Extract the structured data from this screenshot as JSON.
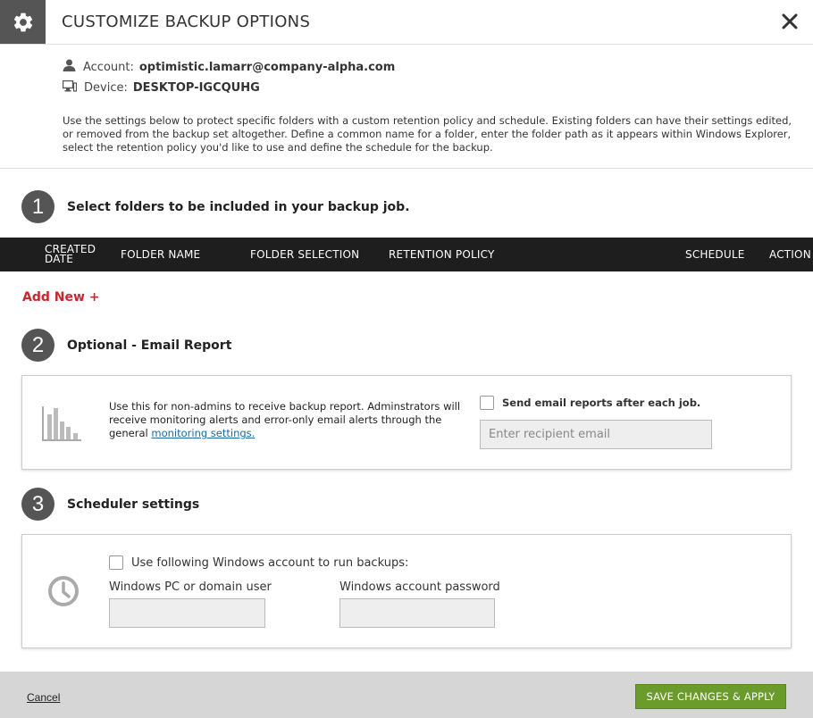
{
  "header": {
    "title": "CUSTOMIZE BACKUP OPTIONS"
  },
  "meta": {
    "account_label": "Account:",
    "account_value": "optimistic.lamarr@company-alpha.com",
    "device_label": "Device:",
    "device_value": "DESKTOP-IGCQUHG",
    "description": "Use the settings below to protect specific folders with a custom retention policy and schedule. Existing folders can have their settings edited, or removed from the backup set altogether. Define a common name for a folder, enter the folder path as it appears within Windows Explorer, select the retention policy you'd like to use and define the schedule for the backup."
  },
  "step1": {
    "number": "1",
    "title": "Select folders to be included in your backup job."
  },
  "table": {
    "columns": {
      "created_date_line1": "CREATED",
      "created_date_line2": "DATE",
      "folder_name": "FOLDER NAME",
      "folder_selection": "FOLDER SELECTION",
      "retention_policy": "RETENTION POLICY",
      "schedule": "SCHEDULE",
      "action": "ACTION"
    }
  },
  "add_new": "Add New +",
  "step2": {
    "number": "2",
    "title": "Optional - Email Report",
    "description": "Use this for non-admins to receive backup report. Adminstrators will receive monitoring alerts and error-only email alerts through the general ",
    "link": "monitoring settings.",
    "checkbox_label": "Send email reports after each job.",
    "email_placeholder": "Enter recipient email"
  },
  "step3": {
    "number": "3",
    "title": "Scheduler settings",
    "checkbox_label": "Use following Windows account to run backups:",
    "user_label": "Windows PC or domain user",
    "password_label": "Windows account password",
    "user_value": "",
    "password_value": ""
  },
  "footer": {
    "cancel": "Cancel",
    "save": "SAVE CHANGES & APPLY"
  },
  "colors": {
    "accent_red": "#c7282d",
    "save_green": "#6b9b2a",
    "header_dark": "#1e1e1e"
  },
  "icons": [
    "gear-icon",
    "close-icon",
    "user-icon",
    "monitor-icon",
    "bar-chart-icon",
    "clock-icon"
  ]
}
